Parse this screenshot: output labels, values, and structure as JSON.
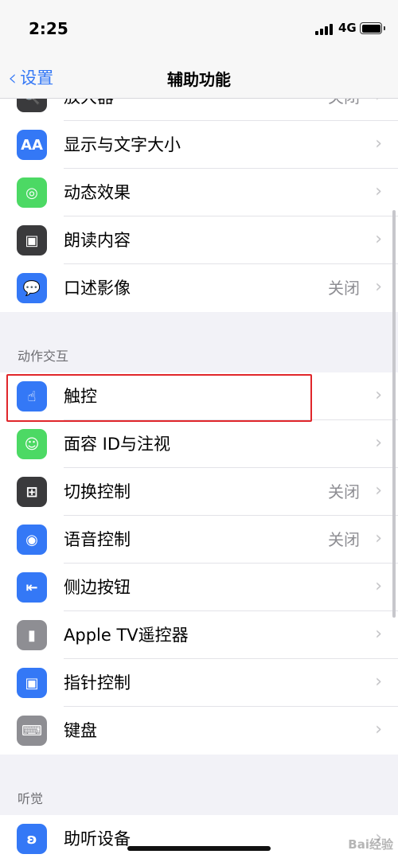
{
  "status_bar": {
    "time": "2:25",
    "network": "4G"
  },
  "nav": {
    "back_label": "设置",
    "title": "辅助功能"
  },
  "group1": [
    {
      "label": "放大器",
      "value": "关闭",
      "icon": "magnifier-icon",
      "color": "#3a3a3c"
    },
    {
      "label": "显示与文字大小",
      "value": "",
      "icon": "text-size-icon",
      "color": "#3478f6"
    },
    {
      "label": "动态效果",
      "value": "",
      "icon": "motion-icon",
      "color": "#4cd964"
    },
    {
      "label": "朗读内容",
      "value": "",
      "icon": "speech-icon",
      "color": "#3a3a3c"
    },
    {
      "label": "口述影像",
      "value": "关闭",
      "icon": "audio-description-icon",
      "color": "#3478f6"
    }
  ],
  "section_interaction": {
    "title": "动作交互"
  },
  "group2": [
    {
      "label": "触控",
      "value": "",
      "icon": "touch-hand-icon",
      "color": "#3478f6"
    },
    {
      "label": "面容 ID与注视",
      "value": "",
      "icon": "face-id-icon",
      "color": "#4cd964"
    },
    {
      "label": "切换控制",
      "value": "关闭",
      "icon": "switch-control-icon",
      "color": "#3a3a3c"
    },
    {
      "label": "语音控制",
      "value": "关闭",
      "icon": "voice-control-icon",
      "color": "#3478f6"
    },
    {
      "label": "侧边按钮",
      "value": "",
      "icon": "side-button-icon",
      "color": "#3478f6"
    },
    {
      "label": "Apple TV遥控器",
      "value": "",
      "icon": "tv-remote-icon",
      "color": "#8e8e93"
    },
    {
      "label": "指针控制",
      "value": "",
      "icon": "pointer-control-icon",
      "color": "#3478f6"
    },
    {
      "label": "键盘",
      "value": "",
      "icon": "keyboard-icon",
      "color": "#8e8e93"
    }
  ],
  "section_hearing": {
    "title": "听觉"
  },
  "group3": [
    {
      "label": "助听设备",
      "value": "",
      "icon": "ear-icon",
      "color": "#3478f6"
    }
  ],
  "chevron": "›",
  "watermark": "Bai经验"
}
